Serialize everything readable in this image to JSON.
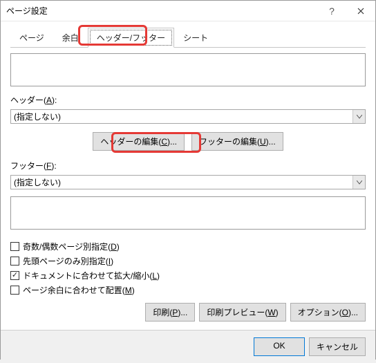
{
  "window": {
    "title": "ページ設定"
  },
  "tabs": {
    "page": "ページ",
    "margins": "余白",
    "header_footer": "ヘッダー/フッター",
    "sheet": "シート"
  },
  "header": {
    "label_prefix": "ヘッダー(",
    "label_key": "A",
    "label_suffix": "):",
    "value": "(指定しない)"
  },
  "footer": {
    "label_prefix": "フッター(",
    "label_key": "F",
    "label_suffix": "):",
    "value": "(指定しない)"
  },
  "edit_buttons": {
    "header_edit_prefix": "ヘッダーの編集(",
    "header_edit_key": "C",
    "header_edit_suffix": ")...",
    "footer_edit_prefix": "フッターの編集(",
    "footer_edit_key": "U",
    "footer_edit_suffix": ")..."
  },
  "checks": {
    "odd_even_prefix": "奇数/偶数ページ別指定(",
    "odd_even_key": "D",
    "odd_even_suffix": ")",
    "odd_even_checked": false,
    "first_page_prefix": "先頭ページのみ別指定(",
    "first_page_key": "I",
    "first_page_suffix": ")",
    "first_page_checked": false,
    "scale_doc_prefix": "ドキュメントに合わせて拡大/縮小(",
    "scale_doc_key": "L",
    "scale_doc_suffix": ")",
    "scale_doc_checked": true,
    "align_margins_prefix": "ページ余白に合わせて配置(",
    "align_margins_key": "M",
    "align_margins_suffix": ")",
    "align_margins_checked": false
  },
  "option_buttons": {
    "print_prefix": "印刷(",
    "print_key": "P",
    "print_suffix": ")...",
    "preview_prefix": "印刷プレビュー(",
    "preview_key": "W",
    "preview_suffix": ")",
    "options_prefix": "オプション(",
    "options_key": "O",
    "options_suffix": ")..."
  },
  "dialog_buttons": {
    "ok": "OK",
    "cancel": "キャンセル"
  }
}
